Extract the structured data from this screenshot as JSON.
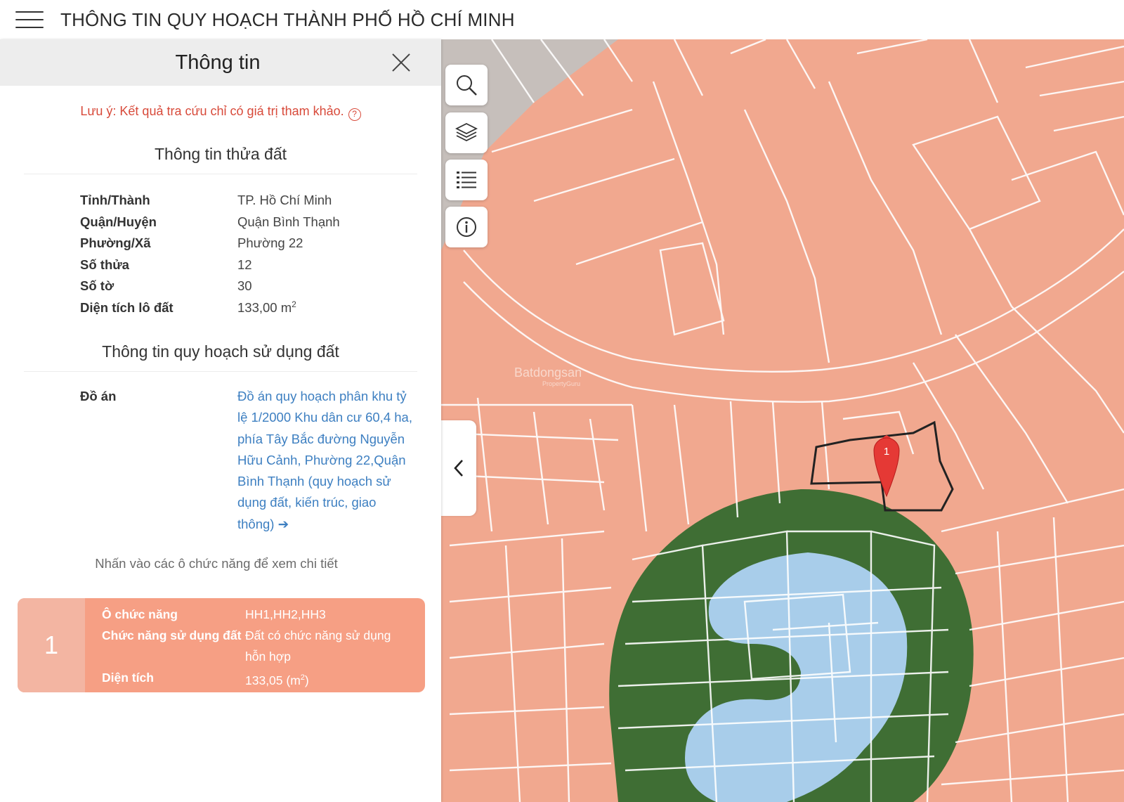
{
  "header": {
    "title": "THÔNG TIN QUY HOẠCH THÀNH PHỐ HỒ CHÍ MINH"
  },
  "panel": {
    "title": "Thông tin",
    "note": "Lưu ý: Kết quả tra cứu chỉ có giá trị tham khảo.",
    "help_glyph": "?",
    "parcel_section_title": "Thông tin thửa đất",
    "parcel": [
      {
        "label": "Tỉnh/Thành",
        "value": "TP. Hồ Chí Minh"
      },
      {
        "label": "Quận/Huyện",
        "value": "Quận Bình Thạnh"
      },
      {
        "label": "Phường/Xã",
        "value": "Phường 22"
      },
      {
        "label": "Số thửa",
        "value": "12"
      },
      {
        "label": "Số tờ",
        "value": "30"
      }
    ],
    "area_label": "Diện tích lô đất",
    "area_value": "133,00 m",
    "area_unit_sup": "2",
    "planning_section_title": "Thông tin quy hoạch sử dụng đất",
    "plan_label": "Đồ án",
    "plan_text": "Đồ án quy hoạch phân khu tỷ lệ 1/2000 Khu dân cư 60,4 ha, phía Tây Bắc đường Nguyễn Hữu Cảnh, Phường 22,Quận Bình Thạnh (quy hoạch sử dụng đất, kiến trúc, giao thông)",
    "plan_arrow": "➔",
    "hint": "Nhấn vào các ô chức năng để xem chi tiết",
    "function_card": {
      "number": "1",
      "rows": [
        {
          "key": "Ô chức năng",
          "value": "HH1,HH2,HH3"
        },
        {
          "key": "Chức năng sử dụng đất",
          "value": "Đất có chức năng sử dụng hỗn hợp"
        }
      ],
      "area_key": "Diện tích",
      "area_value": "133,05 (m",
      "area_sup": "2",
      "area_close": ")"
    }
  },
  "map": {
    "marker_label": "1",
    "watermark": "Batdongsan",
    "watermark_sub": "PropertyGuru",
    "colors": {
      "mixed_use": "#f1a88f",
      "green": "#3f6e34",
      "water": "#a8cdea",
      "road_gray": "#bdbdbd",
      "marker": "#e53935"
    },
    "controls": [
      {
        "name": "search",
        "icon": "search-icon"
      },
      {
        "name": "layers",
        "icon": "layers-icon"
      },
      {
        "name": "legend",
        "icon": "list-icon"
      },
      {
        "name": "info",
        "icon": "info-icon"
      }
    ],
    "toggle_icon": "chevron-left-icon"
  }
}
